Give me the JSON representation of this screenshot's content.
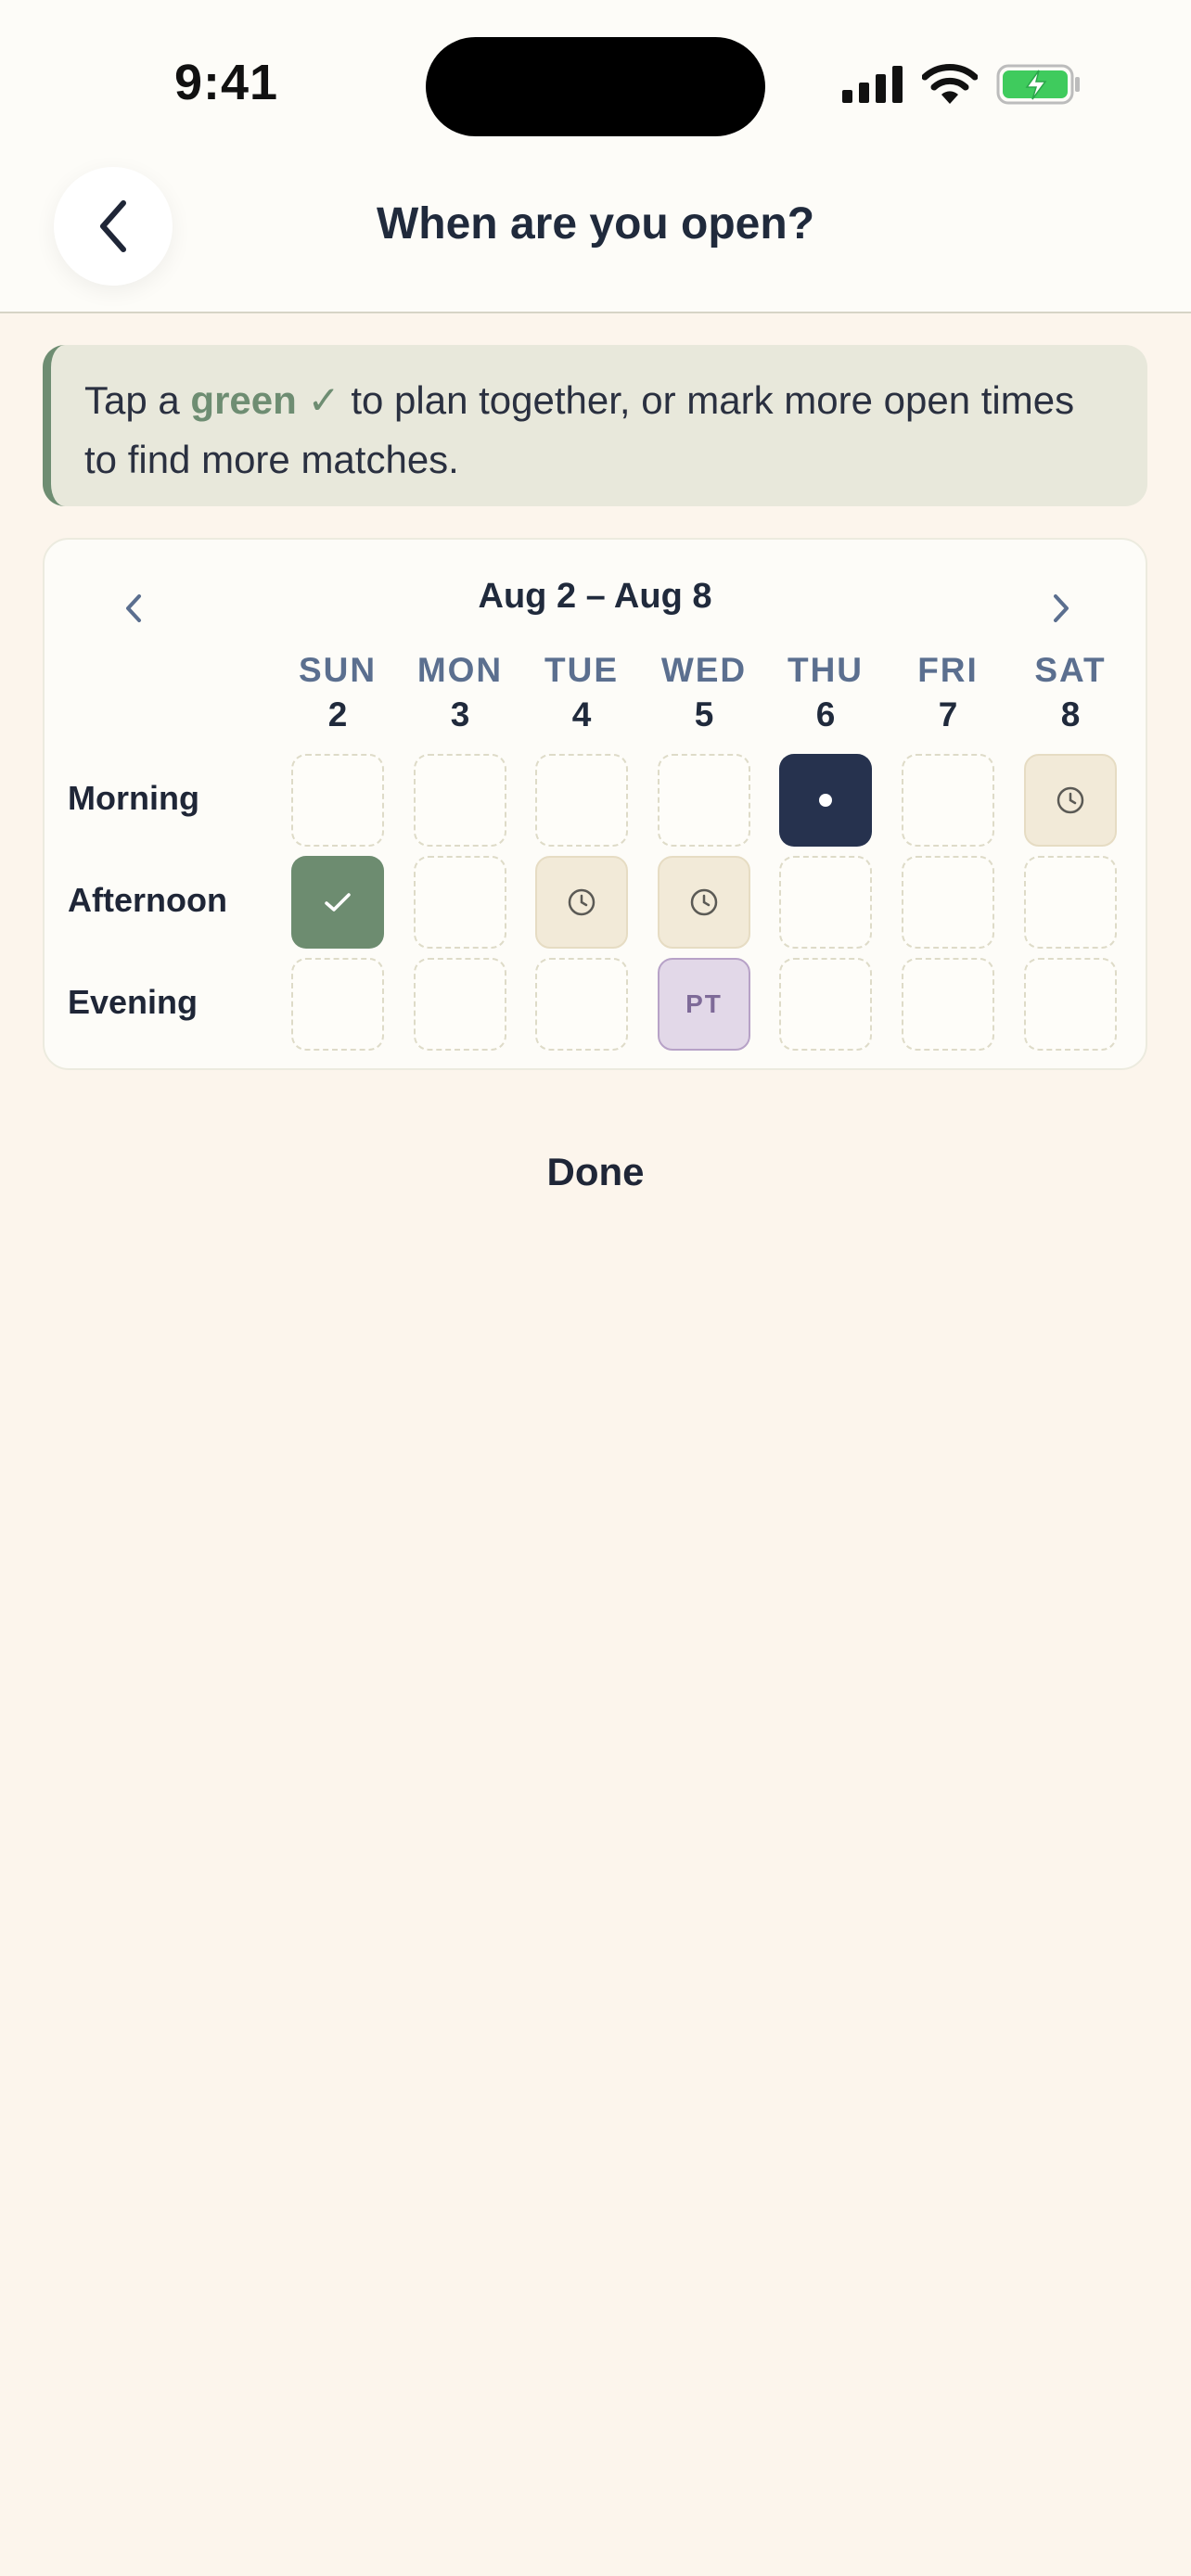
{
  "status_bar": {
    "time": "9:41"
  },
  "header": {
    "title": "When are you open?"
  },
  "tip": {
    "prefix": "Tap a ",
    "green_word": "green",
    "check": "✓",
    "suffix": " to plan together, or mark more open times to find more matches."
  },
  "calendar": {
    "range": "Aug 2 – Aug 8",
    "days": [
      {
        "dow": "SUN",
        "num": "2"
      },
      {
        "dow": "MON",
        "num": "3"
      },
      {
        "dow": "TUE",
        "num": "4"
      },
      {
        "dow": "WED",
        "num": "5"
      },
      {
        "dow": "THU",
        "num": "6"
      },
      {
        "dow": "FRI",
        "num": "7"
      },
      {
        "dow": "SAT",
        "num": "8"
      }
    ],
    "rows": [
      {
        "label": "Morning",
        "cells": [
          "empty",
          "empty",
          "empty",
          "empty",
          "selected-dot",
          "empty",
          "pending-clock"
        ]
      },
      {
        "label": "Afternoon",
        "cells": [
          "match-check",
          "empty",
          "pending-clock",
          "pending-clock",
          "empty",
          "empty",
          "empty"
        ]
      },
      {
        "label": "Evening",
        "cells": [
          "empty",
          "empty",
          "empty",
          "initials",
          "empty",
          "empty",
          "empty"
        ]
      }
    ],
    "initials_label": "PT"
  },
  "footer": {
    "done_label": "Done"
  },
  "colors": {
    "accent_green": "#6d8c70",
    "navy": "#26324e",
    "tan": "#f2ead8",
    "purple": "#e2d8e8"
  }
}
